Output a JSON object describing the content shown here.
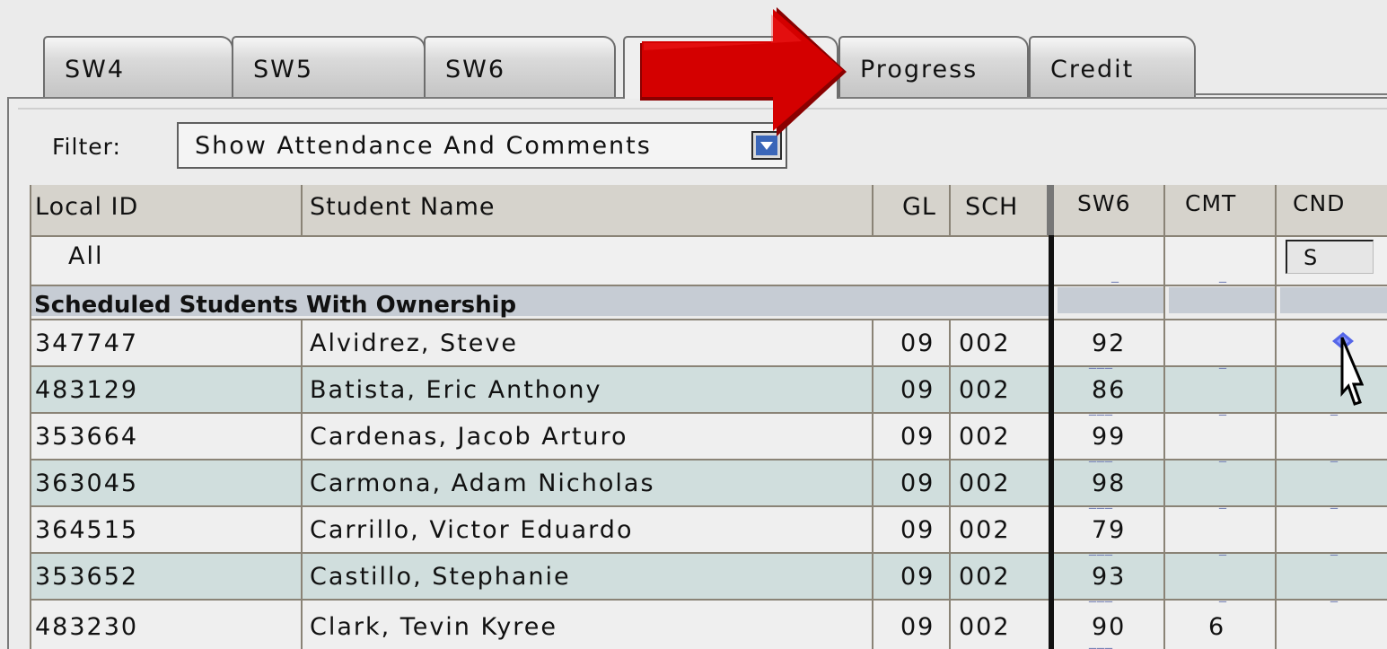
{
  "tabs": [
    "SW4",
    "SW5",
    "SW6",
    "",
    "Progress",
    "Credit"
  ],
  "filter": {
    "label": "Filter:",
    "value": "Show Attendance And Comments"
  },
  "columns": [
    "Local ID",
    "Student Name",
    "GL",
    "SCH",
    "SW6",
    "CMT",
    "CND"
  ],
  "all_row": {
    "label": "All",
    "cnd_value": "S"
  },
  "section_title": "Scheduled Students With Ownership",
  "students": [
    {
      "id": "347747",
      "name": "Alvidrez, Steve",
      "gl": "09",
      "sch": "002",
      "sw6": "92",
      "cmt": "",
      "cnd": ""
    },
    {
      "id": "483129",
      "name": "Batista, Eric Anthony",
      "gl": "09",
      "sch": "002",
      "sw6": "86",
      "cmt": "",
      "cnd": ""
    },
    {
      "id": "353664",
      "name": "Cardenas, Jacob Arturo",
      "gl": "09",
      "sch": "002",
      "sw6": "99",
      "cmt": "",
      "cnd": ""
    },
    {
      "id": "363045",
      "name": "Carmona, Adam Nicholas",
      "gl": "09",
      "sch": "002",
      "sw6": "98",
      "cmt": "",
      "cnd": ""
    },
    {
      "id": "364515",
      "name": "Carrillo, Victor Eduardo",
      "gl": "09",
      "sch": "002",
      "sw6": "79",
      "cmt": "",
      "cnd": ""
    },
    {
      "id": "353652",
      "name": "Castillo, Stephanie",
      "gl": "09",
      "sch": "002",
      "sw6": "93",
      "cmt": "",
      "cnd": ""
    },
    {
      "id": "483230",
      "name": "Clark, Tevin Kyree",
      "gl": "09",
      "sch": "002",
      "sw6": "90",
      "cmt": "6",
      "cnd": ""
    }
  ],
  "colors": {
    "alt_row": "#d0dedd",
    "section_band": "#c6ccd4",
    "arrow": "#cc0000",
    "select_button": "#3a66b8"
  },
  "icons": {
    "arrow": "red-arrow-icon",
    "cursor": "mouse-pointer-icon",
    "diamond": "diamond-icon",
    "dropdown": "dropdown-arrow-icon"
  }
}
